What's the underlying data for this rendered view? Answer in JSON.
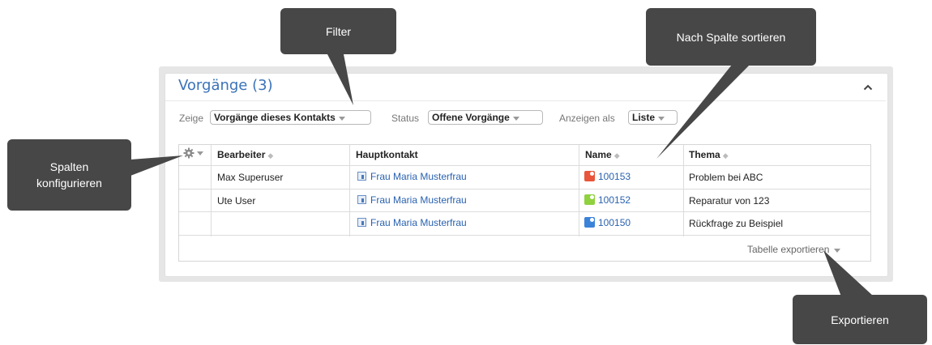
{
  "panel": {
    "title": "Vorgänge (3)",
    "collapse_icon": "chevron-up-icon"
  },
  "filters": {
    "show_label": "Zeige",
    "show_value": "Vorgänge dieses Kontakts",
    "status_label": "Status",
    "status_value": "Offene Vorgänge",
    "view_label": "Anzeigen als",
    "view_value": "Liste"
  },
  "table": {
    "columns": [
      "Bearbeiter",
      "Hauptkontakt",
      "Name",
      "Thema"
    ],
    "rows": [
      {
        "bearbeiter": "Max Superuser",
        "hauptkontakt": "Frau Maria Musterfrau",
        "name": "100153",
        "thema": "Problem bei ABC",
        "status_color": "#e8553a"
      },
      {
        "bearbeiter": "Ute User",
        "hauptkontakt": "Frau Maria Musterfrau",
        "name": "100152",
        "thema": "Reparatur von 123",
        "status_color": "#8fd13f"
      },
      {
        "bearbeiter": "",
        "hauptkontakt": "Frau Maria Musterfrau",
        "name": "100150",
        "thema": "Rückfrage zu Beispiel",
        "status_color": "#3b82d9"
      }
    ],
    "export_label": "Tabelle exportieren"
  },
  "callouts": {
    "filter": "Filter",
    "sort": "Nach Spalte sortieren",
    "columns": "Spalten\nkonfigurieren",
    "export": "Exportieren"
  },
  "colors": {
    "accent": "#3b73b9",
    "link": "#2a62b0",
    "callout_bg": "#474747"
  }
}
